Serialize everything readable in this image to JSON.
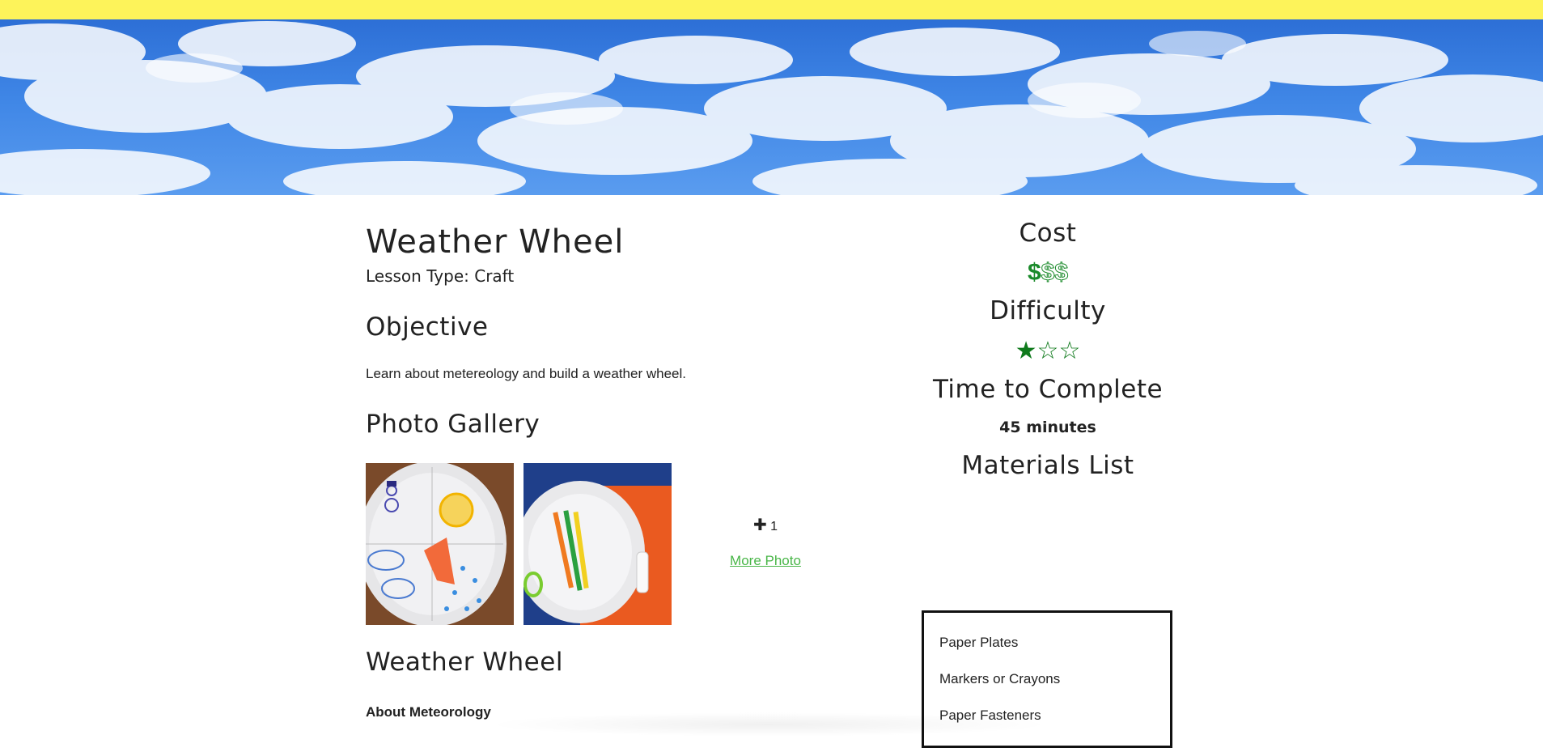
{
  "header": {
    "accent": "#fdf35a"
  },
  "hero": {
    "image": "clouds-sky-banner"
  },
  "lesson": {
    "title": "Weather Wheel",
    "lesson_type": "Lesson Type: Craft"
  },
  "objective": {
    "heading": "Objective",
    "text": "Learn about metereology and build a weather wheel."
  },
  "gallery": {
    "heading": "Photo Gallery",
    "photos": [
      {
        "icon": "paper-plate-weather-wheel-photo"
      },
      {
        "icon": "craft-supplies-photo"
      }
    ],
    "more_count": "1",
    "more_link": "More Photo"
  },
  "section": {
    "heading": "Weather Wheel",
    "subheading": "About Meteorology"
  },
  "cost": {
    "heading": "Cost",
    "level": 1,
    "max": 3,
    "symbol": "$",
    "color": "#1a8a2a"
  },
  "difficulty": {
    "heading": "Difficulty",
    "level": 1,
    "max": 3,
    "filled": "★",
    "empty": "☆"
  },
  "time": {
    "heading": "Time to Complete",
    "value": "45 minutes"
  },
  "materials": {
    "heading": "Materials List",
    "items": [
      "Paper Plates",
      "Markers or Crayons",
      "Paper Fasteners"
    ]
  }
}
